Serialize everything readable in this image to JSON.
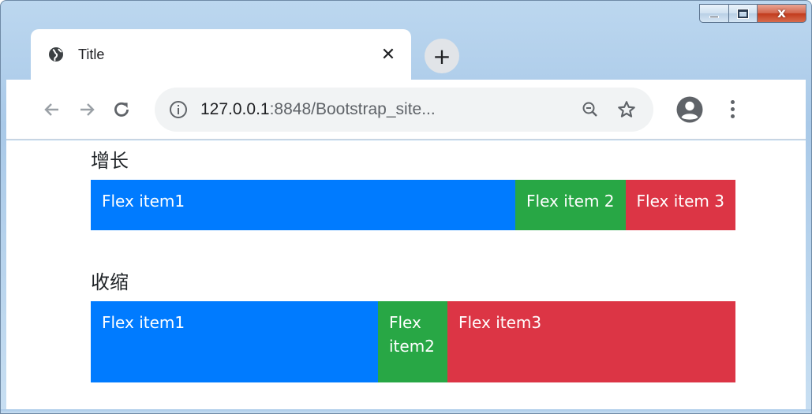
{
  "window": {
    "minimize_label": "minimize",
    "maximize_label": "maximize",
    "close_label": "x"
  },
  "tab": {
    "title": "Title",
    "close_glyph": "✕",
    "new_tab_glyph": "+"
  },
  "toolbar": {
    "url_host": "127.0.0.1",
    "url_rest": ":8848/Bootstrap_site..."
  },
  "sections": [
    {
      "heading": "增长",
      "items": [
        {
          "label": "Flex item1",
          "color": "#007bff"
        },
        {
          "label": "Flex item 2",
          "color": "#28a745"
        },
        {
          "label": "Flex item 3",
          "color": "#dc3545"
        }
      ]
    },
    {
      "heading": "收缩",
      "items": [
        {
          "label": "Flex item1",
          "color": "#007bff"
        },
        {
          "label": "Flex item2",
          "color": "#28a745"
        },
        {
          "label": "Flex item3",
          "color": "#dc3545"
        }
      ]
    }
  ],
  "icons": {
    "favicon": "globe-icon",
    "info": "info-icon",
    "zoom": "zoom-out-icon",
    "bookmark": "star-icon",
    "profile": "account-circle-icon",
    "menu": "more-vert-icon"
  }
}
